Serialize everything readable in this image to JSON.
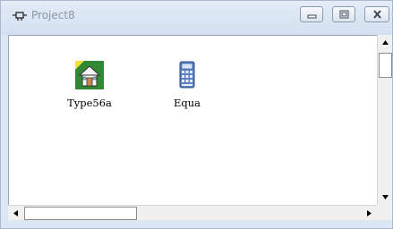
{
  "window": {
    "title": "Project8",
    "controls": {
      "minimize_icon": "minimize-icon",
      "maximize_icon": "maximize-icon",
      "close_icon": "close-icon"
    }
  },
  "items": [
    {
      "label": "Type56a",
      "icon": "house-icon"
    },
    {
      "label": "Equa",
      "icon": "calculator-icon"
    }
  ],
  "colors": {
    "frame": "#dce7f4",
    "client_bg": "#ffffff",
    "title_text": "#8a96a8"
  }
}
